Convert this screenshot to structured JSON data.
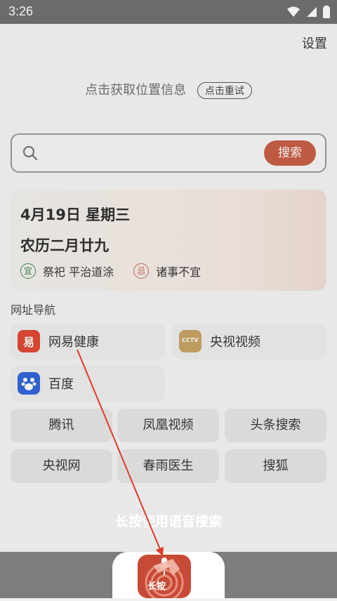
{
  "status": {
    "time": "3:26"
  },
  "header": {
    "settings_label": "设置"
  },
  "location": {
    "text": "点击获取位置信息",
    "retry_label": "点击重试"
  },
  "search": {
    "placeholder": "",
    "button_label": "搜索"
  },
  "calendar": {
    "date": "4月19日 星期三",
    "lunar": "农历二月廿九",
    "good_badge": "宜",
    "good_items": "祭祀 平治道涂",
    "bad_badge": "忌",
    "bad_items": "诸事不宜"
  },
  "nav": {
    "title": "网址导航",
    "icon_cards": [
      {
        "label": "网易健康",
        "icon": "netease-health-icon",
        "color": "#e1452f"
      },
      {
        "label": "央视视频",
        "icon": "cctv-video-icon",
        "color": "#c8a260"
      },
      {
        "label": "百度",
        "icon": "baidu-paw-icon",
        "color": "#2d62d8"
      }
    ],
    "plain_items": [
      "腾讯",
      "凤凰视频",
      "头条搜索",
      "央视网",
      "春雨医生",
      "搜狐"
    ]
  },
  "voice": {
    "hint": "长按使用语音搜索",
    "button_label": "长按"
  },
  "colors": {
    "accent": "#c85c41",
    "voice": "#c64a35"
  }
}
